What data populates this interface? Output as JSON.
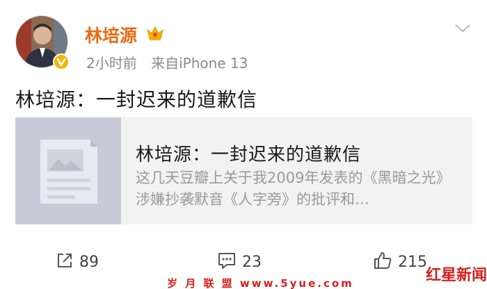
{
  "post": {
    "author": "林培源",
    "time": "2小时前",
    "source": "来自iPhone 13",
    "text": "林培源：一封迟来的道歉信"
  },
  "card": {
    "title": "林培源：一封迟来的道歉信",
    "description": "这几天豆瓣上关于我2009年发表的《黑暗之光》涉嫌抄袭默音《人字旁》的批评和…"
  },
  "actions": {
    "repost_count": "89",
    "comment_count": "23",
    "like_count": "215"
  },
  "watermark": {
    "logo": "红星新闻",
    "bar": "岁 月 联 盟  www.5yue.com"
  },
  "colors": {
    "username": "#e86b10",
    "verified_badge": "#f5b400",
    "card_bg": "#f2f2f2",
    "thumb_bg": "#c8cad8",
    "watermark": "#d81e1e"
  }
}
